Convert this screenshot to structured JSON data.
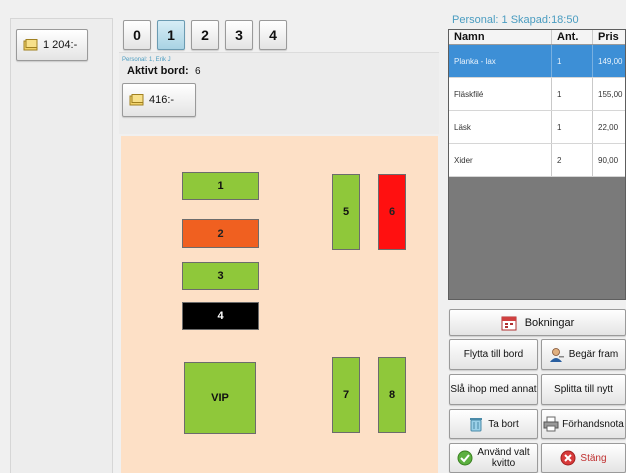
{
  "left_panel": {
    "amount": "1 204:-"
  },
  "tabs": [
    "0",
    "1",
    "2",
    "3",
    "4"
  ],
  "active_tab": "1",
  "info": {
    "small": "Personal: 1, Erik J",
    "active_label": "Aktivt bord:",
    "active_value": "6"
  },
  "table_amount": "416:-",
  "tables": [
    "1",
    "2",
    "3",
    "4",
    "VIP",
    "5",
    "6",
    "7",
    "8"
  ],
  "header_info": "Personal: 1 Skapad:18:50",
  "grid": {
    "columns": [
      "Namn",
      "Ant.",
      "Pris"
    ],
    "rows": [
      {
        "name": "Planka - lax",
        "qty": "1",
        "price": "149,00"
      },
      {
        "name": "Fläskfilé",
        "qty": "1",
        "price": "155,00"
      },
      {
        "name": "Läsk",
        "qty": "1",
        "price": "22,00"
      },
      {
        "name": "Xider",
        "qty": "2",
        "price": "90,00"
      }
    ]
  },
  "buttons": {
    "bokningar": "Bokningar",
    "flytta": "Flytta till bord",
    "begar": "Begär fram",
    "sla_ihop": "Slå ihop med annat",
    "splitta": "Splitta till nytt",
    "ta_bort": "Ta bort",
    "forhandsnota": "Förhandsnota",
    "anvand": "Använd valt kvitto",
    "stang": "Stäng"
  },
  "colors": {
    "selected_row": "#3d8fd6",
    "floor": "#fde0c6",
    "table_green": "#8fc83a",
    "table_orange": "#f06020",
    "table_red": "#ff1010",
    "header_text": "#4a9cc0"
  }
}
